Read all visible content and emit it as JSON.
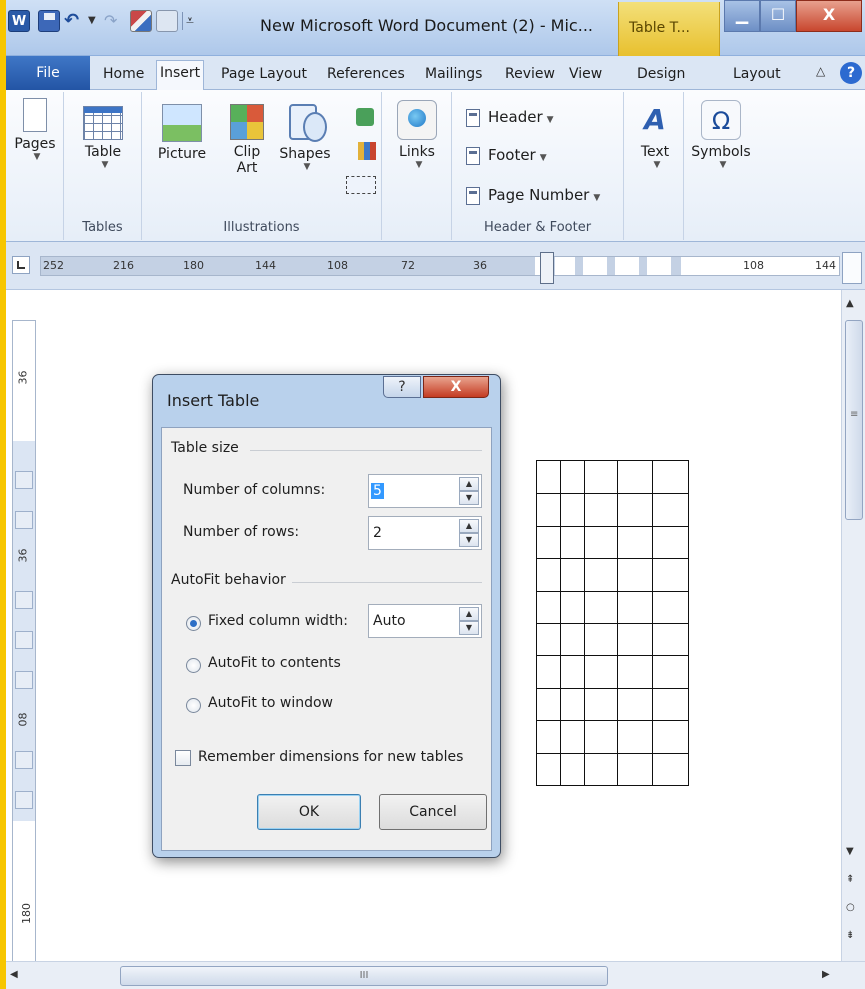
{
  "window": {
    "title": "New Microsoft Word Document (2)  -  Mic...",
    "context_tab": "Table T...",
    "controls": {
      "close": "X"
    }
  },
  "qat": {
    "app_letter": "W"
  },
  "tabs": {
    "file": "File",
    "items": [
      "Home",
      "Insert",
      "Page Layout",
      "References",
      "Mailings",
      "Review",
      "View",
      "Design",
      "Layout"
    ],
    "active": "Insert"
  },
  "ribbon": {
    "pages": "Pages",
    "table": "Table",
    "tables_group": "Tables",
    "picture": "Picture",
    "clip_art": "Clip\nArt",
    "shapes": "Shapes",
    "illustrations_group": "Illustrations",
    "links": "Links",
    "header": "Header",
    "footer": "Footer",
    "page_number": "Page Number",
    "header_footer_group": "Header & Footer",
    "text": "Text",
    "symbols": "Symbols"
  },
  "ruler": {
    "labels": [
      "252",
      "216",
      "180",
      "144",
      "108",
      "72",
      "36",
      "108",
      "144"
    ],
    "vertical_labels": [
      "36",
      "36",
      "08",
      "180"
    ]
  },
  "dialog": {
    "title": "Insert Table",
    "help": "?",
    "close": "X",
    "table_size_label": "Table size",
    "columns_label": "Number of columns:",
    "columns_value": "5",
    "rows_label": "Number of rows:",
    "rows_value": "2",
    "autofit_label": "AutoFit behavior",
    "fixed_width_label": "Fixed column width:",
    "fixed_width_value": "Auto",
    "autofit_contents": "AutoFit to contents",
    "autofit_window": "AutoFit to window",
    "remember": "Remember dimensions for new tables",
    "ok": "OK",
    "cancel": "Cancel",
    "selected_option": "fixed",
    "remember_checked": false
  },
  "preview_table": {
    "columns": 5,
    "rows": 10
  },
  "scroll": {
    "grip": "III"
  },
  "colors": {
    "frame_accent": "#f7c600",
    "title_bar": "#bcd3ef",
    "file_tab": "#2a5fb2",
    "dialog_close": "#c8462e"
  }
}
